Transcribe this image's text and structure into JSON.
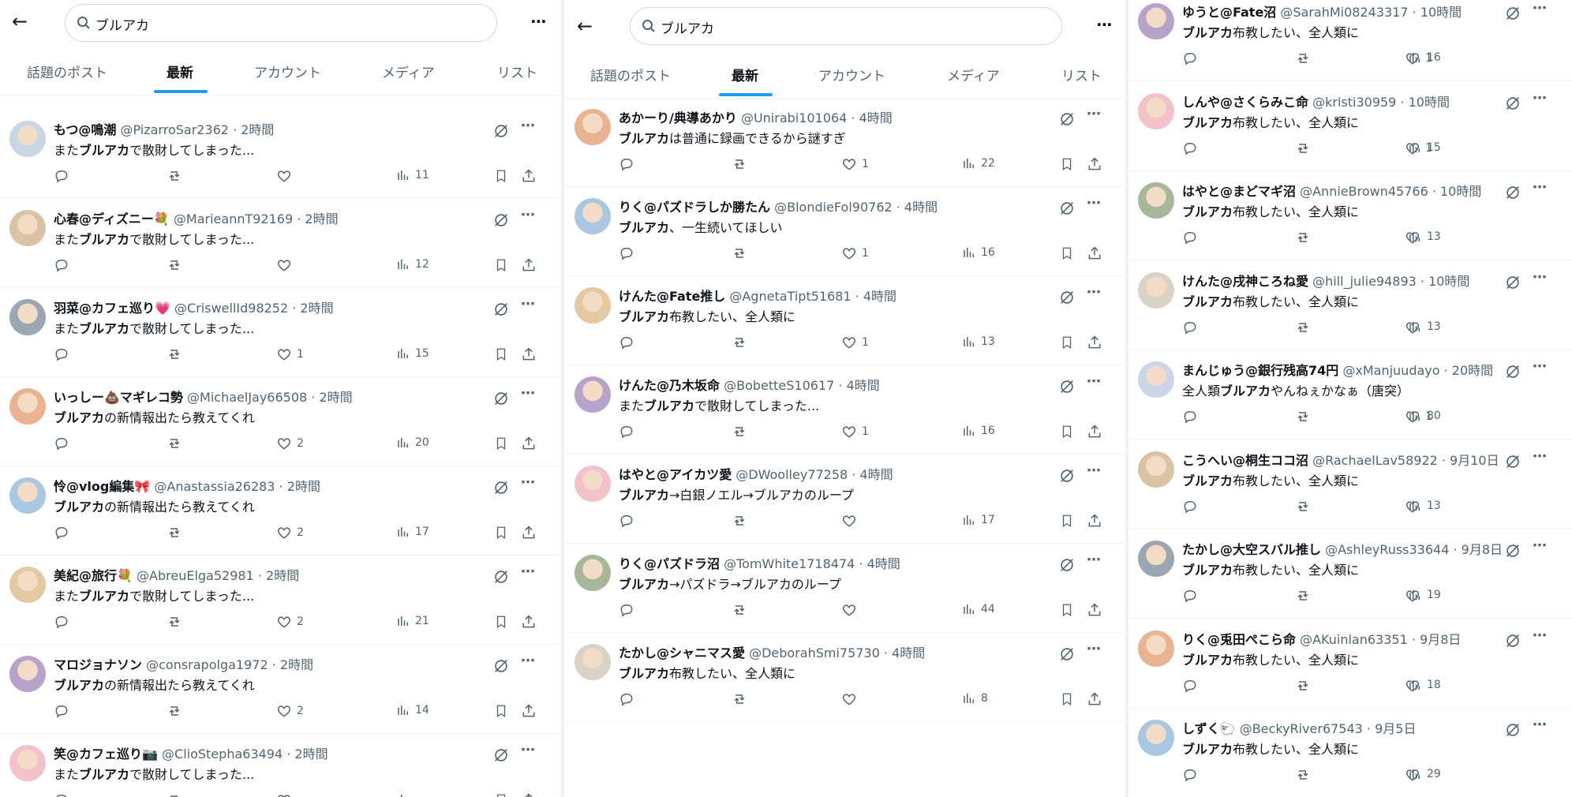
{
  "search": {
    "query": "ブルアカ"
  },
  "tabs": [
    "話題のポスト",
    "最新",
    "アカウント",
    "メディア",
    "リスト"
  ],
  "active_tab": "最新",
  "colors": {
    "accent": "#1d9bf0",
    "text": "#0f1419",
    "muted": "#536471"
  },
  "panels": [
    {
      "id": "panel-1",
      "tweets": [
        {
          "name": "もつ@鳴潮",
          "handle": "@PizarroSar2362 · 2時間",
          "text": [
            "また",
            "ブルアカ",
            "で散財してしまった..."
          ],
          "likes": "",
          "views": "11"
        },
        {
          "name": "心春@ディズニー💐",
          "handle": "@MarieannT92169 · 2時間",
          "text": [
            "また",
            "ブルアカ",
            "で散財してしまった..."
          ],
          "likes": "",
          "views": "12"
        },
        {
          "name": "羽菜@カフェ巡り💗",
          "handle": "@CriswellId98252 · 2時間",
          "text": [
            "また",
            "ブルアカ",
            "で散財してしまった..."
          ],
          "likes": "1",
          "views": "15"
        },
        {
          "name": "いっしー💩マギレコ勢",
          "handle": "@MichaelJay66508 · 2時間",
          "text": [
            "",
            "ブルアカ",
            "の新情報出たら教えてくれ"
          ],
          "likes": "2",
          "views": "20"
        },
        {
          "name": "怜@vlog編集🎀",
          "handle": "@Anastassia26283 · 2時間",
          "text": [
            "",
            "ブルアカ",
            "の新情報出たら教えてくれ"
          ],
          "likes": "2",
          "views": "17"
        },
        {
          "name": "美紀@旅行💐",
          "handle": "@AbreuElga52981 · 2時間",
          "text": [
            "また",
            "ブルアカ",
            "で散財してしまった..."
          ],
          "likes": "2",
          "views": "21"
        },
        {
          "name": "マロジョナソン",
          "handle": "@consrapolga1972 · 2時間",
          "text": [
            "",
            "ブルアカ",
            "の新情報出たら教えてくれ"
          ],
          "likes": "2",
          "views": "14"
        },
        {
          "name": "笑@カフェ巡り📷",
          "handle": "@ClioStepha63494 · 2時間",
          "text": [
            "また",
            "ブルアカ",
            "で散財してしまった..."
          ],
          "likes": "",
          "views": ""
        }
      ]
    },
    {
      "id": "panel-2",
      "tweets": [
        {
          "name": "あかーり/典導あかり",
          "handle": "@Unirabi101064 · 4時間",
          "text": [
            "",
            "ブルアカ",
            "は普通に録画できるから謎すぎ"
          ],
          "likes": "1",
          "views": "22"
        },
        {
          "name": "りく@パズドラしか勝たん",
          "handle": "@BlondieFol90762 · 4時間",
          "text": [
            "",
            "ブルアカ",
            "、一生続いてほしい"
          ],
          "likes": "1",
          "views": "16"
        },
        {
          "name": "けんた@Fate推し",
          "handle": "@AgnetaTipt51681 · 4時間",
          "text": [
            "",
            "ブルアカ",
            "布教したい、全人類に"
          ],
          "likes": "1",
          "views": "13"
        },
        {
          "name": "けんた@乃木坂命",
          "handle": "@BobetteS10617 · 4時間",
          "text": [
            "また",
            "ブルアカ",
            "で散財してしまった..."
          ],
          "likes": "1",
          "views": "16"
        },
        {
          "name": "はやと@アイカツ愛",
          "handle": "@DWoolley77258 · 4時間",
          "text": [
            "",
            "ブルアカ",
            "→白銀ノエル→ブルアカのループ"
          ],
          "likes": "",
          "views": "17"
        },
        {
          "name": "りく@パズドラ沼",
          "handle": "@TomWhite1718474 · 4時間",
          "text": [
            "",
            "ブルアカ",
            "→パズドラ→ブルアカのループ"
          ],
          "likes": "",
          "views": "44"
        },
        {
          "name": "たかし@シャニマス愛",
          "handle": "@DeborahSmi75730 · 4時間",
          "text": [
            "",
            "ブルアカ",
            "布教したい、全人類に"
          ],
          "likes": "",
          "views": "8"
        }
      ]
    },
    {
      "id": "panel-3",
      "tweets": [
        {
          "name": "ゆうと@Fate沼",
          "handle": "@SarahMi08243317 · 10時間",
          "text": [
            "",
            "ブルアカ",
            "布教したい、全人類に"
          ],
          "likes": "1",
          "views": "16"
        },
        {
          "name": "しんや@さくらみこ命",
          "handle": "@kristi30959 · 10時間",
          "text": [
            "",
            "ブルアカ",
            "布教したい、全人類に"
          ],
          "likes": "1",
          "views": "15"
        },
        {
          "name": "はやと@まどマギ沼",
          "handle": "@AnnieBrown45766 · 10時間",
          "text": [
            "",
            "ブルアカ",
            "布教したい、全人類に"
          ],
          "likes": "",
          "views": "13"
        },
        {
          "name": "けんた@戌神ころね愛",
          "handle": "@hill_julie94893 · 10時間",
          "text": [
            "",
            "ブルアカ",
            "布教したい、全人類に"
          ],
          "likes": "",
          "views": "13"
        },
        {
          "name": "まんじゅう@銀行残高74円",
          "handle": "@xManjuudayo · 20時間",
          "text": [
            "全人類",
            "ブルアカ",
            "やんねぇかなぁ（唐突）"
          ],
          "likes": "1",
          "views": "80"
        },
        {
          "name": "こうへい@桐生ココ沼",
          "handle": "@RachaelLav58922 · 9月10日",
          "text": [
            "",
            "ブルアカ",
            "布教したい、全人類に"
          ],
          "likes": "",
          "views": "13"
        },
        {
          "name": "たかし@大空スバル推し",
          "handle": "@AshleyRuss33644 · 9月8日",
          "text": [
            "",
            "ブルアカ",
            "布教したい、全人類に"
          ],
          "likes": "",
          "views": "19"
        },
        {
          "name": "りく@兎田ぺこら命",
          "handle": "@AKuinlan63351 · 9月8日",
          "text": [
            "",
            "ブルアカ",
            "布教したい、全人類に"
          ],
          "likes": "",
          "views": "18"
        },
        {
          "name": "しずく🐑",
          "handle": "@BeckyRiver67543 · 9月5日",
          "text": [
            "",
            "ブルアカ",
            "布教したい、全人類に"
          ],
          "likes": "",
          "views": "29"
        }
      ]
    }
  ]
}
